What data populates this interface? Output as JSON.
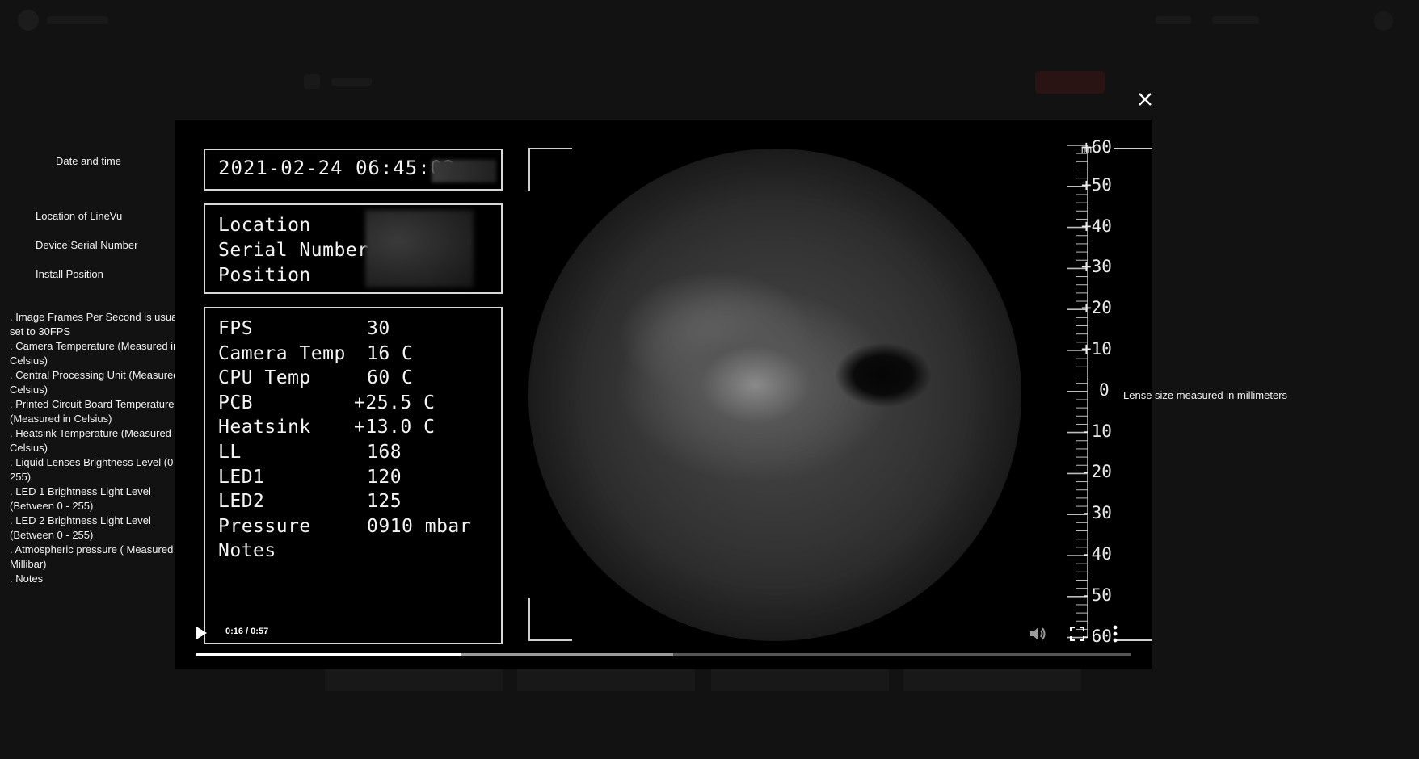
{
  "annotations": {
    "date_time": "Date and time",
    "location": "Location of LineVu",
    "serial": "Device Serial Number",
    "position": "Install Position",
    "items": [
      ". Image Frames Per Second  is usually set to 30FPS",
      ". Camera Temperature (Measured in Celsius)",
      ". Central Processing Unit (Measured in Celsius)",
      ". Printed Circuit Board Temperature (Measured in Celsius)",
      ". Heatsink Temperature (Measured in Celsius)",
      ". Liquid Lenses Brightness Level (0 - 255)",
      ". LED 1 Brightness Light Level (Between 0 - 255)",
      ". LED 2 Brightness Light Level (Between 0 - 255)",
      ". Atmospheric pressure ( Measured in Millibar)",
      ". Notes"
    ],
    "lens_note": "Lense size measured in millimeters"
  },
  "close_icon": "close-icon",
  "overlay": {
    "datetime": "2021-02-24 06:45:02",
    "info_labels": [
      "Location",
      "Serial Number",
      "Position"
    ],
    "stats": [
      {
        "key": "FPS",
        "value": "30"
      },
      {
        "key": "Camera Temp",
        "value": "16 C"
      },
      {
        "key": "CPU Temp",
        "value": "60 C"
      },
      {
        "key": "PCB",
        "value": "+25.5 C"
      },
      {
        "key": "Heatsink",
        "value": "+13.0 C"
      },
      {
        "key": "LL",
        "value": "168"
      },
      {
        "key": "LED1",
        "value": "120"
      },
      {
        "key": "LED2",
        "value": "125"
      },
      {
        "key": "Pressure",
        "value": "0910 mbar"
      },
      {
        "key": "Notes",
        "value": ""
      }
    ],
    "scale_top": "+60",
    "scale_unit": "mm",
    "scale_labels": [
      "+50",
      "+40",
      "+30",
      "+20",
      "+10",
      "0",
      "-10",
      "-20",
      "-30",
      "-40",
      "-50",
      "-60"
    ]
  },
  "player": {
    "time": "0:16 / 0:57",
    "played_fraction": 0.284,
    "buffered_fraction": 0.51,
    "icons": [
      "play-icon",
      "volume-icon",
      "fullscreen-icon",
      "more-vertical-icon"
    ]
  },
  "colors": {
    "backdrop": "#111111",
    "video_bg": "#000000",
    "overlay_text": "#f4f4f4",
    "progress_played": "#ffffff",
    "progress_buffered": "#9a9a9a"
  }
}
